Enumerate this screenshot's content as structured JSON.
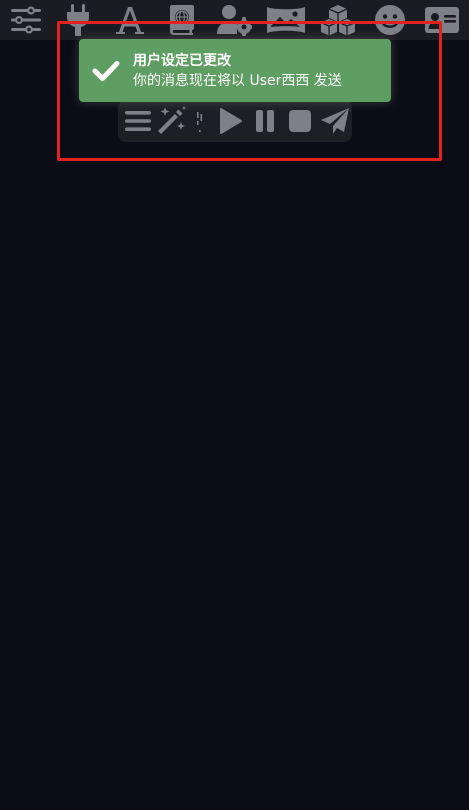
{
  "topbar": {
    "icons": [
      "sliders-icon",
      "plug-icon",
      "font-icon",
      "book-atlas-icon",
      "user-gear-icon",
      "image-panorama-icon",
      "cubes-icon",
      "smile-icon",
      "id-card-icon"
    ]
  },
  "actionbar": {
    "icons": [
      "menu-icon",
      "magic-wand-icon",
      "drag-handle-icon",
      "play-icon",
      "pause-icon",
      "stop-icon",
      "send-icon"
    ]
  },
  "toast": {
    "title": "用户设定已更改",
    "message": "你的消息现在将以 User西西 发送",
    "icon": "check-icon",
    "color": "#5f9e62"
  },
  "colors": {
    "background": "#0b0c15",
    "topbar": "#1b1c22",
    "icon": "#7f8087",
    "highlight": "#e2221f"
  }
}
